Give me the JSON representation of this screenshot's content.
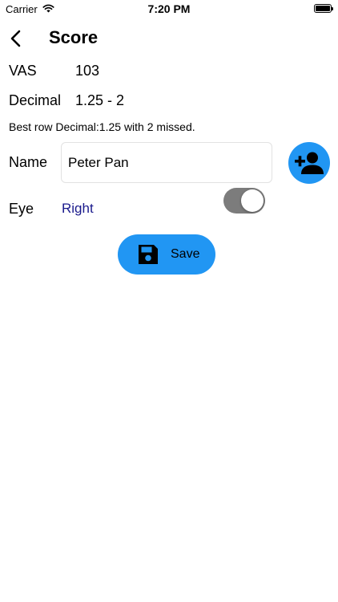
{
  "status_bar": {
    "carrier": "Carrier",
    "time": "7:20 PM"
  },
  "nav": {
    "title": "Score"
  },
  "vas": {
    "label": "VAS",
    "value": "103"
  },
  "decimal": {
    "label": "Decimal",
    "value": "1.25 - 2"
  },
  "best_row_text": "Best row Decimal:1.25 with 2 missed.",
  "name": {
    "label": "Name",
    "value": "Peter Pan"
  },
  "eye": {
    "label": "Eye",
    "value": "Right",
    "toggle_on": true
  },
  "save_button": {
    "label": "Save"
  },
  "colors": {
    "accent": "#2196f3",
    "eye_value": "#1a1a8c",
    "toggle_track": "#7c7c7c"
  },
  "icons": {
    "back": "chevron-left-icon",
    "add_person": "person-add-icon",
    "save": "floppy-disk-icon",
    "wifi": "wifi-icon",
    "battery": "battery-icon"
  }
}
